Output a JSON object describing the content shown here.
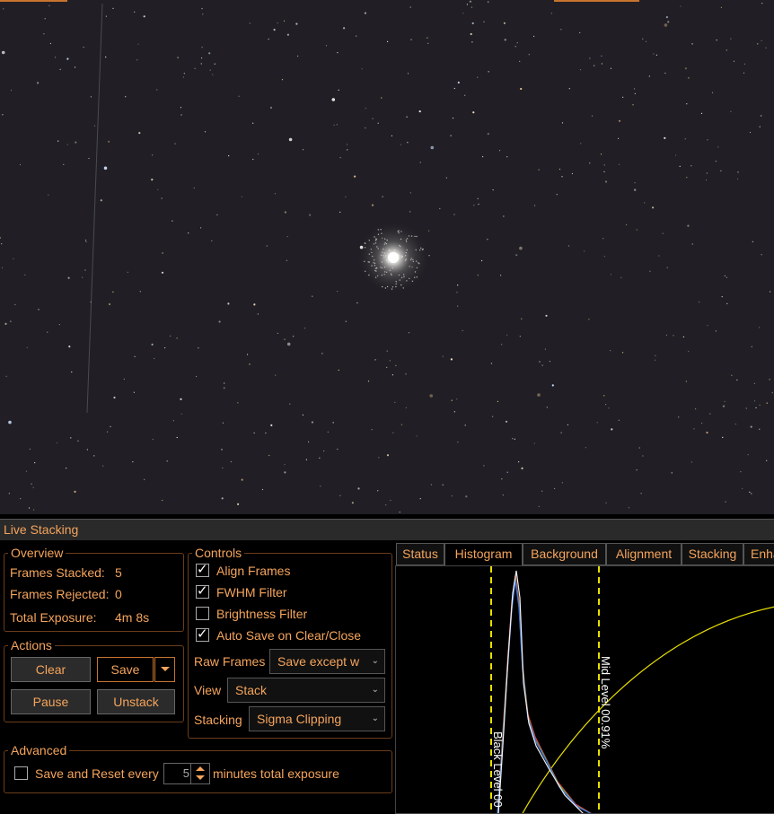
{
  "panel": {
    "title": "Live Stacking"
  },
  "overview": {
    "legend": "Overview",
    "frames_stacked_label": "Frames Stacked:",
    "frames_stacked_value": "5",
    "frames_rejected_label": "Frames Rejected:",
    "frames_rejected_value": "0",
    "total_exposure_label": "Total Exposure:",
    "total_exposure_value": "4m 8s"
  },
  "actions": {
    "legend": "Actions",
    "clear": "Clear",
    "save": "Save",
    "pause": "Pause",
    "unstack": "Unstack"
  },
  "controls": {
    "legend": "Controls",
    "checkboxes": [
      {
        "label": "Align Frames",
        "checked": true
      },
      {
        "label": "FWHM Filter",
        "checked": true
      },
      {
        "label": "Brightness Filter",
        "checked": false
      },
      {
        "label": "Auto Save on Clear/Close",
        "checked": true
      }
    ],
    "raw_frames_label": "Raw Frames",
    "raw_frames_value": "Save except w",
    "view_label": "View",
    "view_value": "Stack",
    "stacking_label": "Stacking",
    "stacking_value": "Sigma Clipping"
  },
  "advanced": {
    "legend": "Advanced",
    "checkbox_label": "Save and Reset every",
    "checked": false,
    "minutes_value": "5",
    "suffix": "minutes total exposure"
  },
  "tabs": [
    {
      "label": "Status",
      "active": false
    },
    {
      "label": "Histogram",
      "active": true
    },
    {
      "label": "Background",
      "active": false
    },
    {
      "label": "Alignment",
      "active": false
    },
    {
      "label": "Stacking",
      "active": false
    },
    {
      "label": "Enhance",
      "active": false
    }
  ],
  "histogram": {
    "black_level_label": "Black Level 00",
    "mid_level_label": "Mid Level 00.91%"
  },
  "colors": {
    "accent": "#f5a45c",
    "border": "#6b3d1a",
    "marker": "#e8e000",
    "background": "#000000"
  }
}
